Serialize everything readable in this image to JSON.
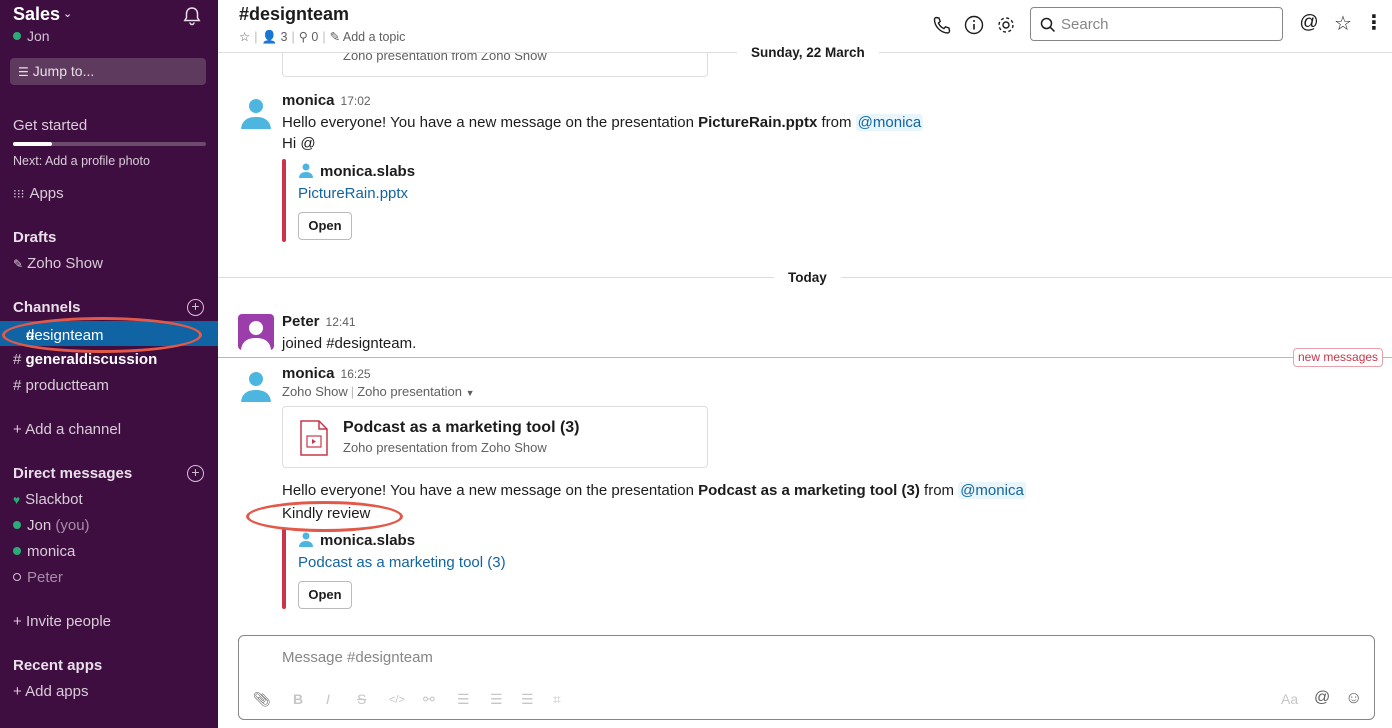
{
  "workspace": {
    "name": "Sales",
    "user": "Jon"
  },
  "sidebar": {
    "jump_to": "Jump to...",
    "get_started": "Get started",
    "next_step": "Next: Add a profile photo",
    "apps": "Apps",
    "drafts_header": "Drafts",
    "drafts": [
      "Zoho Show"
    ],
    "channels_header": "Channels",
    "channels": [
      "designteam",
      "generaldiscussion",
      "productteam"
    ],
    "add_channel": "Add a channel",
    "dm_header": "Direct messages",
    "dms": [
      {
        "name": "Slackbot",
        "suffix": ""
      },
      {
        "name": "Jon",
        "suffix": "(you)"
      },
      {
        "name": "monica",
        "suffix": ""
      },
      {
        "name": "Peter",
        "suffix": ""
      }
    ],
    "invite": "Invite people",
    "recent_apps_header": "Recent apps",
    "add_apps": "Add apps"
  },
  "header": {
    "title": "#designteam",
    "members": "3",
    "pins": "0",
    "topic": "Add a topic",
    "search_placeholder": "Search"
  },
  "messages": {
    "prev_card_sub": "Zoho presentation from Zoho Show",
    "day1": "Sunday, 22 March",
    "m1": {
      "author": "monica",
      "time": "17:02",
      "text_a": "Hello everyone! You have a new message on the presentation ",
      "file": "PictureRain.pptx",
      "text_b": " from ",
      "mention": "@monica",
      "line2": "Hi @",
      "att_user": "monica.slabs",
      "att_link": "PictureRain.pptx",
      "open": "Open"
    },
    "day2": "Today",
    "m2": {
      "author": "Peter",
      "time": "12:41",
      "text": "joined #designteam."
    },
    "new_messages": "new messages",
    "m3": {
      "author": "monica",
      "time": "16:25",
      "app_a": "Zoho Show",
      "app_b": "Zoho presentation",
      "card_title": "Podcast as a marketing tool (3)",
      "card_sub": "Zoho presentation from Zoho Show",
      "text_a": "Hello everyone! You have a new message on the presentation ",
      "file": "Podcast as a marketing tool (3)",
      "text_b": " from ",
      "mention": "@monica",
      "line2": "Kindly review",
      "att_user": "monica.slabs",
      "att_link": "Podcast as a marketing tool (3)",
      "open": "Open"
    }
  },
  "composer": {
    "placeholder": "Message #designteam",
    "aa": "Aa"
  },
  "colors": {
    "sidebar": "#3f0e40",
    "active_channel": "#1164a3",
    "link": "#1264a3",
    "annotation": "#e2594a",
    "new_messages": "#c9364a"
  }
}
